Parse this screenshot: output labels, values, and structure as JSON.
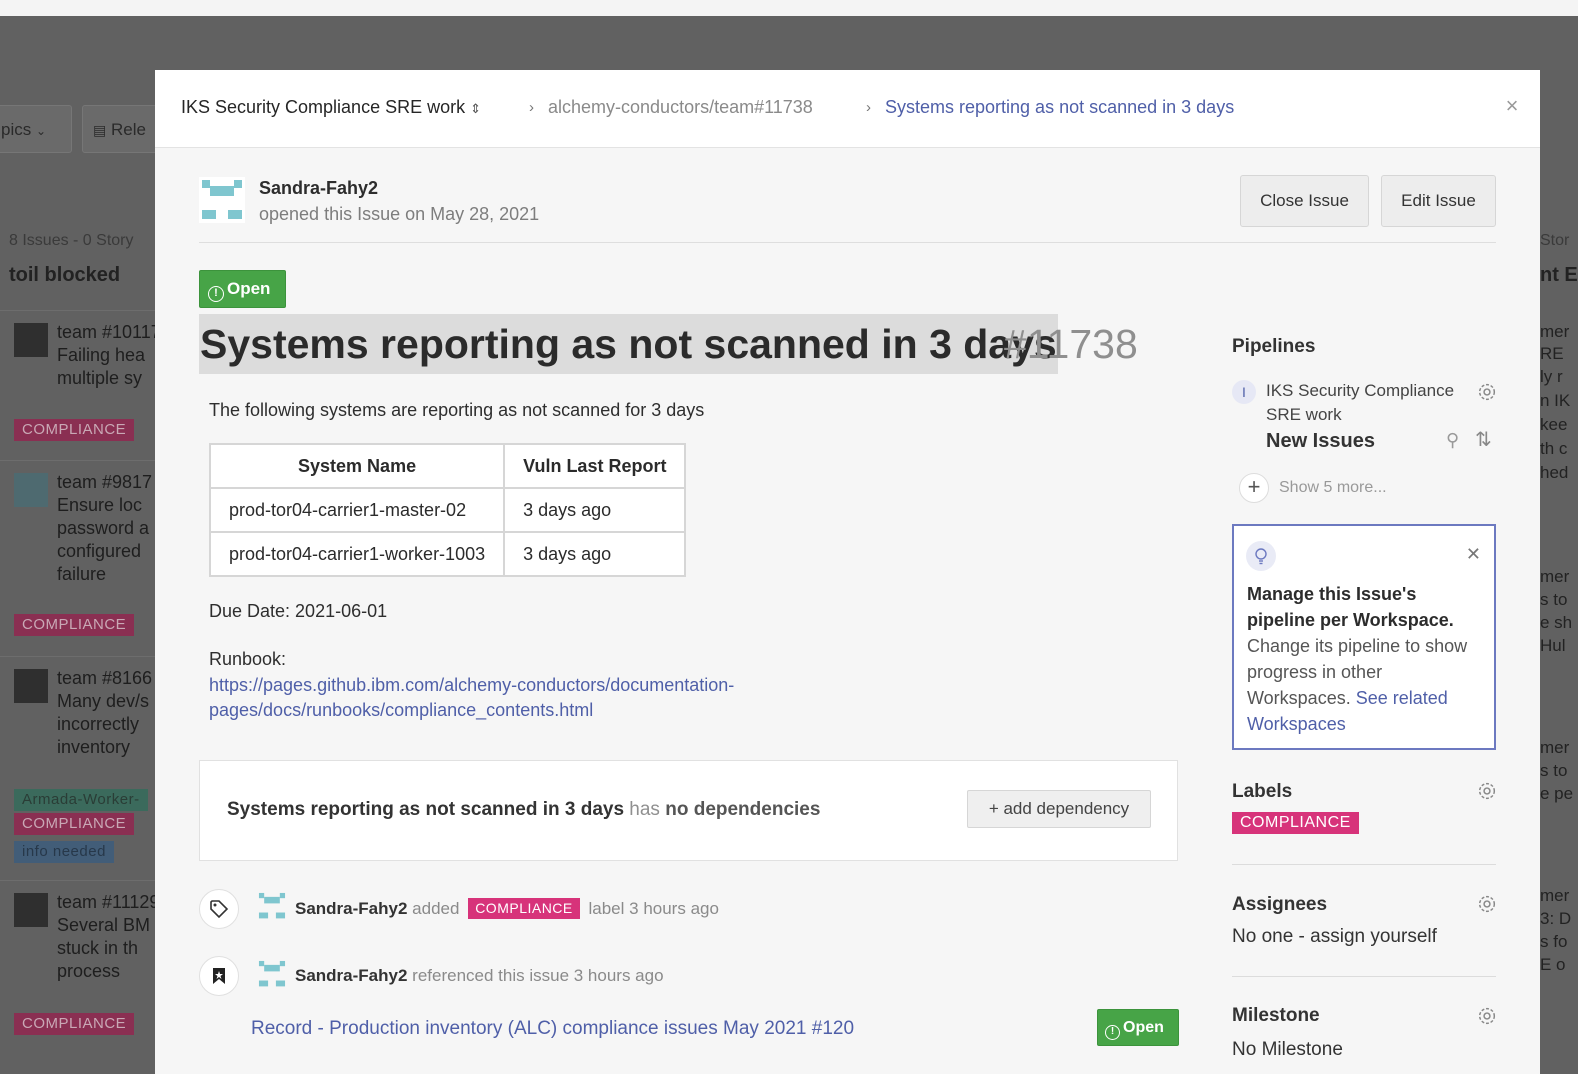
{
  "background": {
    "chips": [
      "pics",
      "Rele"
    ],
    "column_meta": "8 Issues - 0 Story",
    "column_title": "toil blocked",
    "cards": [
      {
        "lines": [
          "team #10117",
          "Failing hea",
          "multiple sy"
        ]
      },
      {
        "lines": [
          "team #9817",
          "Ensure loc",
          "password a",
          "configured",
          "failure"
        ]
      },
      {
        "lines": [
          "team #8166",
          "Many dev/s",
          "incorrectly",
          "inventory"
        ]
      },
      {
        "lines": [
          "team #11129",
          "Several BM",
          "stuck in th",
          "process"
        ]
      }
    ],
    "card_labels": [
      "COMPLIANCE",
      "COMPLIANCE",
      "Armada-Worker-",
      "COMPLIANCE",
      "info needed",
      "COMPLIANCE"
    ],
    "right_col_meta": "Stor",
    "right_col_title": "nt E",
    "right_texts": [
      "mer",
      "RE",
      "ly r",
      "n IK",
      "kee",
      "th c",
      "hed",
      "mer",
      "s to",
      "e sh",
      "Hul",
      "mer",
      "s to",
      "e pe",
      "mer",
      "3: D",
      "s fo",
      "E o"
    ]
  },
  "breadcrumb": {
    "workspace": "IKS Security Compliance SRE work",
    "repo": "alchemy-conductors/team#11738",
    "issue_title": "Systems reporting as not scanned in 3 days"
  },
  "author": {
    "name": "Sandra-Fahy2",
    "meta": "opened this Issue on May 28, 2021"
  },
  "actions": {
    "close_issue": "Close Issue",
    "edit_issue": "Edit Issue"
  },
  "issue": {
    "status": "Open",
    "title": "Systems reporting as not scanned in 3 days",
    "number": "#11738",
    "intro": "The following systems are reporting as not scanned for 3 days",
    "table": {
      "headers": [
        "System Name",
        "Vuln Last Report"
      ],
      "rows": [
        [
          "prod-tor04-carrier1-master-02",
          "3 days ago"
        ],
        [
          "prod-tor04-carrier1-worker-1003",
          "3 days ago"
        ]
      ]
    },
    "due_date": "Due Date: 2021-06-01",
    "runbook_label": "Runbook:",
    "runbook_link_line1": "https://pages.github.ibm.com/alchemy-conductors/documentation-",
    "runbook_link_line2": "pages/docs/runbooks/compliance_contents.html"
  },
  "dependencies": {
    "title": "Systems reporting as not scanned in 3 days",
    "has": "has",
    "none": "no dependencies",
    "add_button": "+ add dependency"
  },
  "timeline": [
    {
      "user": "Sandra-Fahy2",
      "action": "added",
      "label": "COMPLIANCE",
      "suffix": "label 3 hours ago"
    },
    {
      "user": "Sandra-Fahy2",
      "action": "referenced this issue 3 hours ago"
    }
  ],
  "reference": {
    "link": "Record - Production inventory (ALC) compliance issues May 2021 #120",
    "status": "Open"
  },
  "sidebar": {
    "pipelines_heading": "Pipelines",
    "pipeline_initial": "I",
    "pipeline_workspace": "IKS Security Compliance SRE work",
    "pipeline_name": "New Issues",
    "show_more": "Show 5 more...",
    "tip_bold": "Manage this Issue's pipeline per Workspace.",
    "tip_body": "Change its pipeline to show progress in other Workspaces.",
    "tip_link": "See related Workspaces",
    "labels_heading": "Labels",
    "label": "COMPLIANCE",
    "assignees_heading": "Assignees",
    "assignees_value": "No one - assign yourself",
    "milestone_heading": "Milestone",
    "milestone_value": "No Milestone"
  },
  "colors": {
    "accent": "#4f5fa8",
    "open_green": "#47a447",
    "compliance_pink": "#d7337a"
  }
}
